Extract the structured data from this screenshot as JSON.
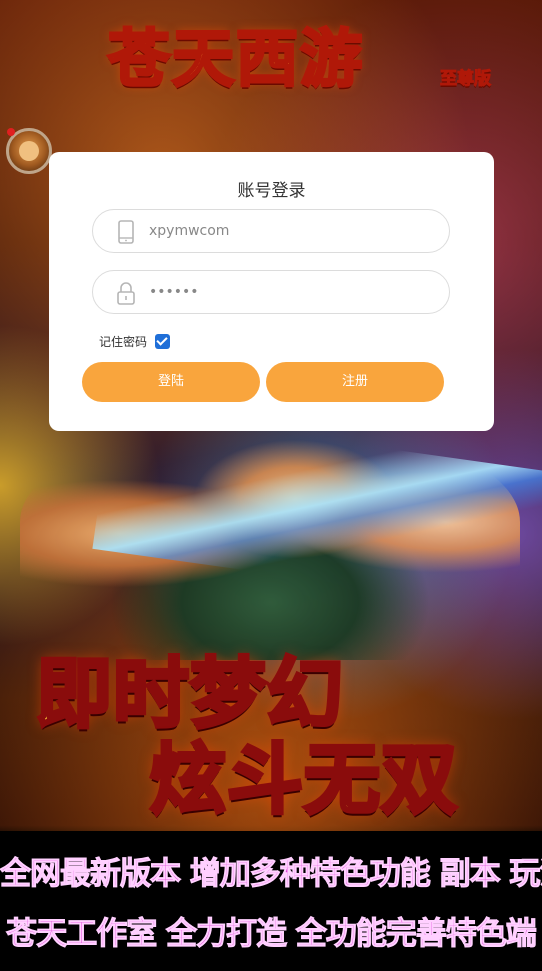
{
  "background": {
    "title_art": "苍天西游",
    "title_badge": "至尊版",
    "slogan_line_1": "即时梦幻",
    "slogan_line_2": "炫斗无双",
    "promo_line_1": "全网最新版本 增加多种特色功能 副本 玩法",
    "promo_line_2": "苍天工作室 全力打造 全功能完善特色端"
  },
  "login": {
    "title": "账号登录",
    "account_value": "xpymwcom",
    "password_value": "••••••",
    "remember_label": "记住密码",
    "remember_checked": true,
    "login_button": "登陆",
    "register_button": "注册"
  },
  "colors": {
    "button": "#f9a53d",
    "checkbox": "#1f6fd8"
  },
  "icons": {
    "account": "phone-icon",
    "password": "lock-icon"
  }
}
